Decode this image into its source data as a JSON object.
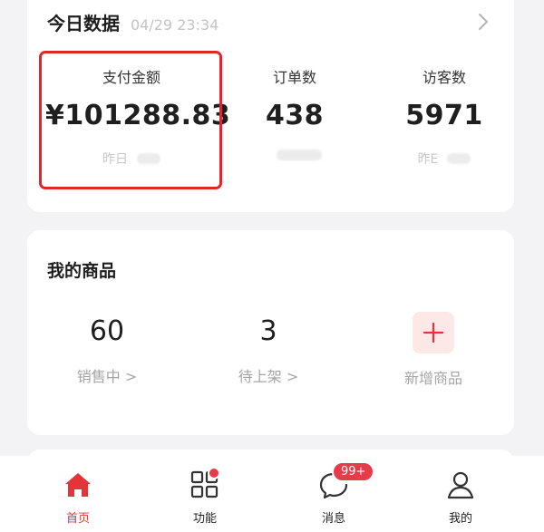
{
  "today": {
    "title": "今日数据",
    "time": "04/29 23:34",
    "stats": [
      {
        "label": "支付金额",
        "value": "¥101288.83",
        "sub": "昨日"
      },
      {
        "label": "订单数",
        "value": "438",
        "sub": ""
      },
      {
        "label": "访客数",
        "value": "5971",
        "sub": "昨E"
      }
    ]
  },
  "goods": {
    "title": "我的商品",
    "items": [
      {
        "value": "60",
        "label": "销售中 >"
      },
      {
        "value": "3",
        "label": "待上架 >"
      },
      {
        "label": "新增商品"
      }
    ]
  },
  "tabs": [
    {
      "label": "首页",
      "icon": "home-icon",
      "active": true
    },
    {
      "label": "功能",
      "icon": "grid-icon"
    },
    {
      "label": "消息",
      "icon": "chat-icon",
      "badge": "99+"
    },
    {
      "label": "我的",
      "icon": "user-icon"
    }
  ],
  "colors": {
    "accent": "#e3343a",
    "highlight": "#e0262b",
    "badge": "#e63b49"
  }
}
